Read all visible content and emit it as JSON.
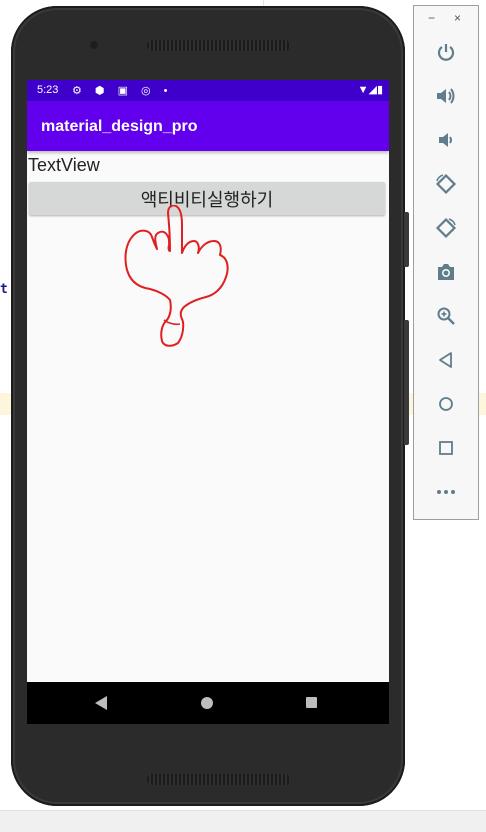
{
  "status_bar": {
    "time": "5:23",
    "icons": "⚙ ⬢ ▣ ◎ •",
    "right_icons": "▼◢▮"
  },
  "app_bar": {
    "title": "material_design_pro"
  },
  "content": {
    "textview": "TextView",
    "action_button_label": "액티비티실행하기"
  },
  "ide": {
    "gutter_glyph": "t"
  },
  "emulator_toolbar": {
    "minimize": "−",
    "close": "×",
    "buttons": [
      "power-icon",
      "volume-up-icon",
      "volume-down-icon",
      "rotate-left-icon",
      "rotate-right-icon",
      "camera-icon",
      "zoom-icon",
      "back-icon",
      "home-icon",
      "overview-icon",
      "more-icon"
    ]
  },
  "colors": {
    "status_bar": "#3f00cc",
    "app_bar": "#6200ee",
    "toolbar_icon": "#607d8b",
    "scribble": "#e02020"
  }
}
